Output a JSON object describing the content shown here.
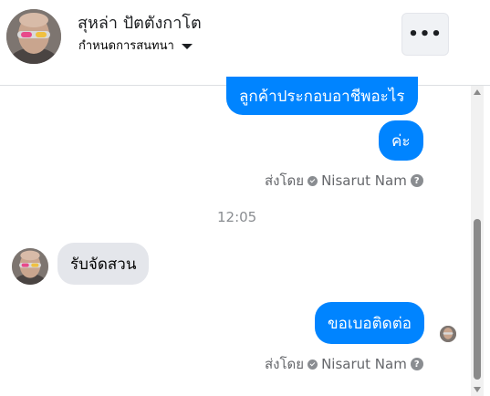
{
  "header": {
    "name": "สุหล่า ปัตตังกาโต",
    "subtitle": "กำหนดการสนทนา"
  },
  "messages": {
    "out_1": "ลูกค้าประกอบอาชีพอะไร",
    "out_2": "ค่ะ",
    "sent_by_1": "ส่งโดย",
    "sender_1": "Nisarut Nam",
    "time": "12:05",
    "in_1": "รับจัดสวน",
    "out_3": "ขอเบอติดต่อ",
    "sent_by_2": "ส่งโดย",
    "sender_2": "Nisarut Nam"
  },
  "icons": {
    "more": "more-horizontal-icon",
    "caret": "caret-down-icon",
    "verified": "check-circle-icon",
    "help": "question-circle-icon"
  },
  "colors": {
    "accent": "#0084ff",
    "incoming_bubble": "#e4e6eb"
  }
}
